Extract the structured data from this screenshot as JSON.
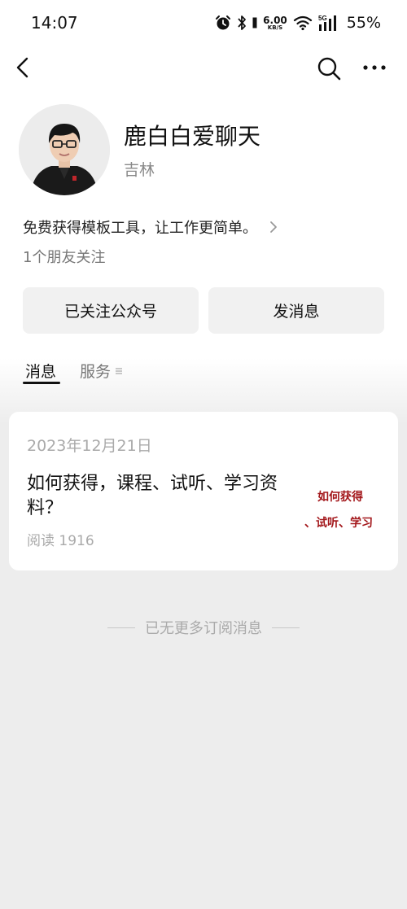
{
  "status_bar": {
    "time": "14:07",
    "net_speed_value": "6.00",
    "net_speed_unit": "KB/S",
    "network_type": "5G",
    "battery": "55%",
    "icons": [
      "alarm-icon",
      "bluetooth-icon",
      "wifi-icon",
      "signal-icon"
    ]
  },
  "nav": {
    "icons": [
      "back-arrow-icon",
      "search-icon",
      "more-icon"
    ]
  },
  "profile": {
    "name": "鹿白白爱聊天",
    "region": "吉林",
    "intro": "免费获得模板工具，让工作更简单。",
    "friends_following": "1个朋友关注"
  },
  "actions": {
    "followed_label": "已关注公众号",
    "message_label": "发消息"
  },
  "tabs": {
    "messages": "消息",
    "services": "服务"
  },
  "article": {
    "date": "2023年12月21日",
    "title": "如何获得，课程、试听、学习资料？",
    "reads": "阅读 1916",
    "thumbnail_line1": "如何获得",
    "thumbnail_line2": "、试听、学习"
  },
  "footer": {
    "no_more": "已无更多订阅消息"
  },
  "colors": {
    "background": "#ededed",
    "card": "#ffffff",
    "button": "#f1f1f1",
    "thumbnail_text": "#a3171b"
  }
}
